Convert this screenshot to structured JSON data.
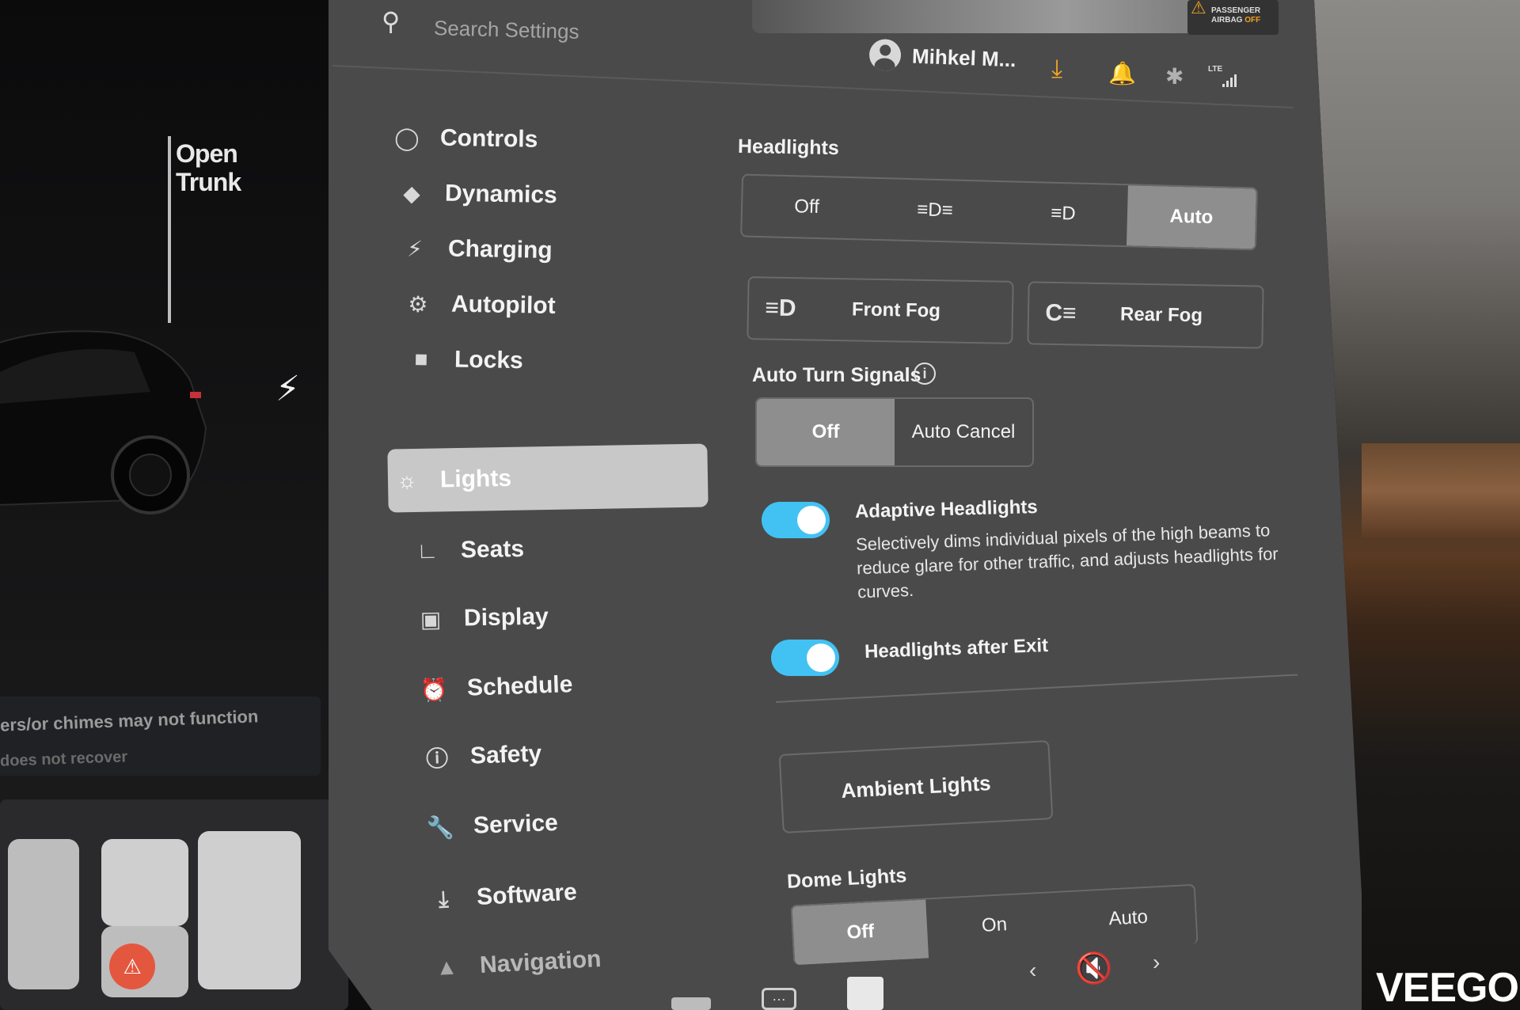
{
  "search": {
    "placeholder": "Search Settings"
  },
  "profile": {
    "name": "Mihkel M..."
  },
  "airbag": {
    "line1": "PASSENGER",
    "line2": "AIRBAG",
    "status": "OFF"
  },
  "status_bar": {
    "network": "LTE"
  },
  "car_panel": {
    "trunk_label": "Open Trunk",
    "warning_line1": "ers/or chimes may not function",
    "warning_line2": "does not recover"
  },
  "sidebar": {
    "items": [
      {
        "label": "Controls",
        "icon": "toggle-icon",
        "active": false
      },
      {
        "label": "Dynamics",
        "icon": "car-icon",
        "active": false
      },
      {
        "label": "Charging",
        "icon": "bolt-icon",
        "active": false
      },
      {
        "label": "Autopilot",
        "icon": "steering-wheel-icon",
        "active": false
      },
      {
        "label": "Locks",
        "icon": "lock-icon",
        "active": false
      },
      {
        "label": "Lights",
        "icon": "sun-icon",
        "active": true
      },
      {
        "label": "Seats",
        "icon": "seat-icon",
        "active": false
      },
      {
        "label": "Display",
        "icon": "display-icon",
        "active": false
      },
      {
        "label": "Schedule",
        "icon": "alarm-clock-icon",
        "active": false
      },
      {
        "label": "Safety",
        "icon": "alert-circle-icon",
        "active": false
      },
      {
        "label": "Service",
        "icon": "wrench-icon",
        "active": false
      },
      {
        "label": "Software",
        "icon": "download-icon",
        "active": false
      },
      {
        "label": "Navigation",
        "icon": "navigation-arrow-icon",
        "active": false
      }
    ]
  },
  "lights": {
    "headlights": {
      "label": "Headlights",
      "options": [
        "Off",
        "≡D≡",
        "≡D",
        "Auto"
      ],
      "selected": "Auto"
    },
    "fog": {
      "front_label": "Front Fog",
      "rear_label": "Rear Fog"
    },
    "auto_turn_signals": {
      "label": "Auto Turn Signals",
      "options": [
        "Off",
        "Auto Cancel"
      ],
      "selected": "Off"
    },
    "adaptive_headlights": {
      "title": "Adaptive Headlights",
      "description": "Selectively dims individual pixels of the high beams to reduce glare for other traffic, and adjusts headlights for curves.",
      "enabled": true
    },
    "headlights_after_exit": {
      "title": "Headlights after Exit",
      "enabled": true
    },
    "ambient_lights_label": "Ambient Lights",
    "dome_lights": {
      "label": "Dome Lights",
      "options": [
        "Off",
        "On",
        "Auto"
      ],
      "selected": "Off"
    }
  },
  "watermark": "VEEGO",
  "colors": {
    "toggle_on": "#42c2f2",
    "download_accent": "#f5a623",
    "screen_bg": "#4a4a4b",
    "selected_segment": "#8e8e8f"
  }
}
